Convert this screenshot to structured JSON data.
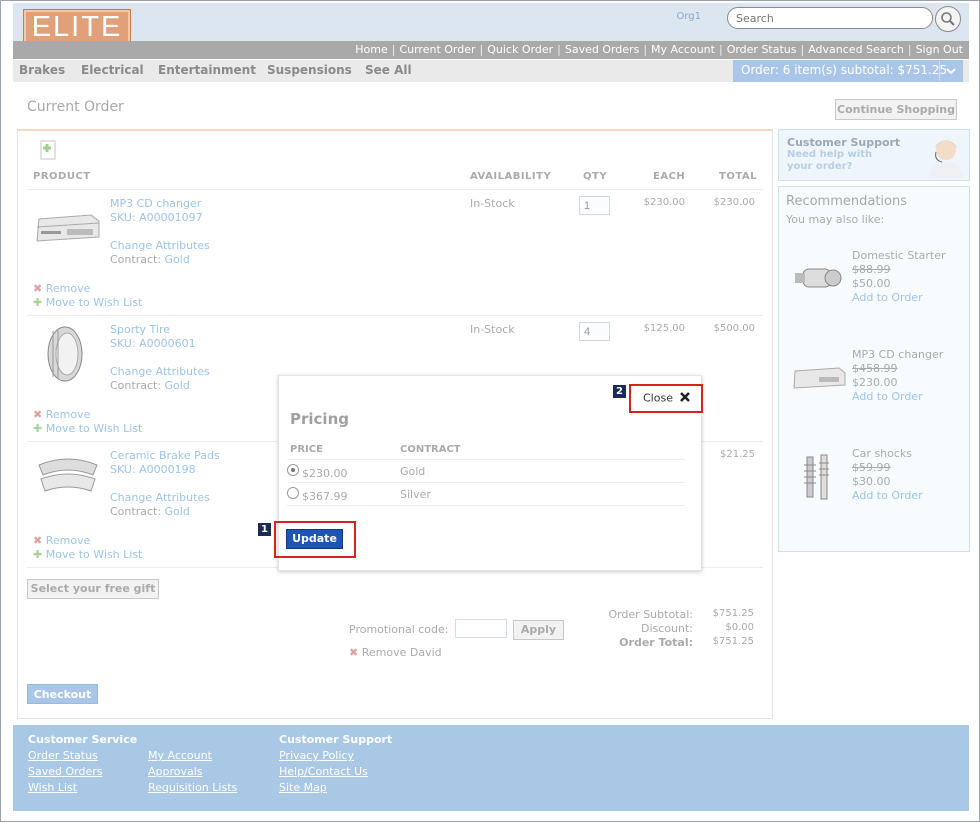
{
  "header": {
    "logo_text": "ELITE",
    "org": "Org1",
    "search_placeholder": "Search",
    "top_links": [
      "Home",
      "Current Order",
      "Quick Order",
      "Saved Orders",
      "My Account",
      "Order Status",
      "Advanced Search",
      "Sign Out"
    ],
    "categories": [
      "Brakes",
      "Electrical",
      "Entertainment",
      "Suspensions",
      "See All"
    ],
    "cart_summary": "Order: 6 item(s) subtotal: $751.25"
  },
  "page": {
    "title": "Current Order",
    "continue_shopping": "Continue Shopping"
  },
  "table": {
    "headers": [
      "PRODUCT",
      "AVAILABILITY",
      "QTY",
      "EACH",
      "TOTAL"
    ],
    "rows": [
      {
        "name": "MP3 CD changer",
        "sku": "SKU: A00001097",
        "availability": "In-Stock",
        "qty": "1",
        "each": "$230.00",
        "total": "$230.00",
        "change_attr": "Change Attributes",
        "contract_label": "Contract:",
        "contract": "Gold",
        "remove": "Remove",
        "wish": "Move to Wish List"
      },
      {
        "name": "Sporty Tire",
        "sku": "SKU: A0000601",
        "availability": "In-Stock",
        "qty": "4",
        "each": "$125.00",
        "total": "$500.00",
        "change_attr": "Change Attributes",
        "contract_label": "Contract:",
        "contract": "Gold",
        "remove": "Remove",
        "wish": "Move to Wish List"
      },
      {
        "name": "Ceramic Brake Pads",
        "sku": "SKU: A0000198",
        "availability": "",
        "qty": "",
        "each": "",
        "total": "$21.25",
        "change_attr": "Change Attributes",
        "contract_label": "Contract:",
        "contract": "Gold",
        "remove": "Remove",
        "wish": "Move to Wish List"
      }
    ]
  },
  "order": {
    "free_gift": "Select your free gift",
    "promo_label": "Promotional code:",
    "apply": "Apply",
    "remove_promo": "Remove David",
    "subtotal_label": "Order Subtotal:",
    "subtotal": "$751.25",
    "discount_label": "Discount:",
    "discount": "$0.00",
    "total_label": "Order Total:",
    "total": "$751.25",
    "checkout": "Checkout"
  },
  "support": {
    "title": "Customer Support",
    "line1": "Need help with",
    "line2": "your order?"
  },
  "recommendations": {
    "title": "Recommendations",
    "subtitle": "You may also like:",
    "items": [
      {
        "name": "Domestic Starter",
        "old": "$88.99",
        "price": "$50.00",
        "add": "Add to Order"
      },
      {
        "name": "MP3 CD changer",
        "old": "$458.99",
        "price": "$230.00",
        "add": "Add to Order"
      },
      {
        "name": "Car shocks",
        "old": "$59.99",
        "price": "$30.00",
        "add": "Add to Order"
      }
    ]
  },
  "footer": {
    "col1_title": "Customer Service",
    "col1": [
      "Order Status",
      "Saved Orders",
      "Wish List"
    ],
    "col2": [
      "My Account",
      "Approvals",
      "Requisition Lists"
    ],
    "col3_title": "Customer Support",
    "col3": [
      "Privacy Policy",
      "Help/Contact Us",
      "Site Map"
    ]
  },
  "modal": {
    "title": "Pricing",
    "close": "Close",
    "col_price": "PRICE",
    "col_contract": "CONTRACT",
    "options": [
      {
        "price": "$230.00",
        "contract": "Gold",
        "selected": true
      },
      {
        "price": "$367.99",
        "contract": "Silver",
        "selected": false
      }
    ],
    "update": "Update",
    "marker1": "1",
    "marker2": "2"
  },
  "colors": {
    "accent_blue": "#1e54b5",
    "highlight_red": "#d5231f",
    "link_blue": "#9cc4e8"
  }
}
